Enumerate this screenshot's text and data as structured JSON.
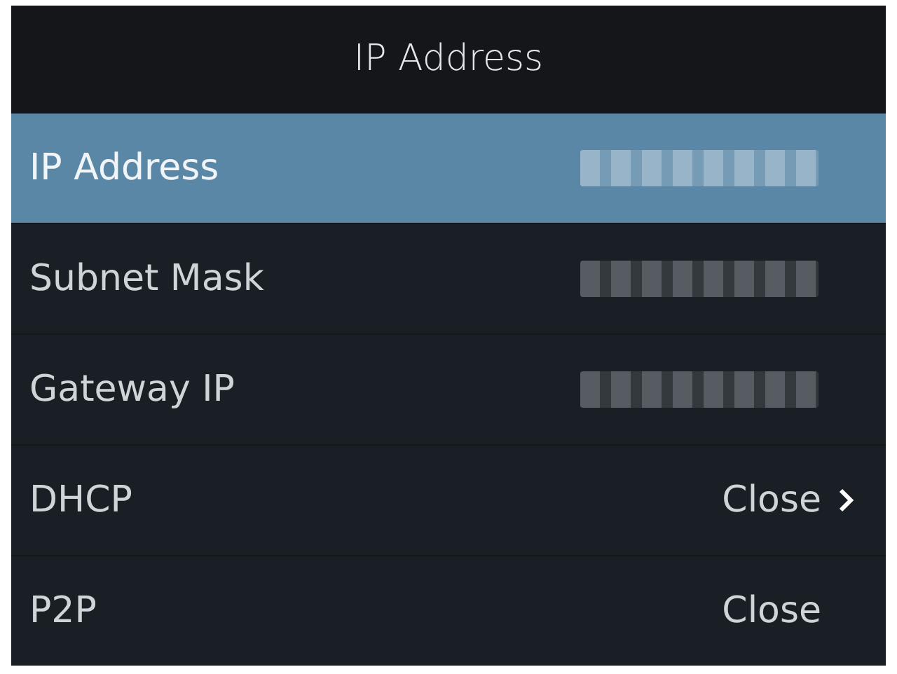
{
  "header": {
    "title": "IP Address"
  },
  "rows": [
    {
      "label": "IP Address",
      "kind": "masked",
      "selected": true,
      "arrow": false
    },
    {
      "label": "Subnet Mask",
      "kind": "masked",
      "selected": false,
      "arrow": false
    },
    {
      "label": "Gateway IP",
      "kind": "masked",
      "selected": false,
      "arrow": false
    },
    {
      "label": "DHCP",
      "kind": "text",
      "value": "Close",
      "selected": false,
      "arrow": true
    },
    {
      "label": "P2P",
      "kind": "text",
      "value": "Close",
      "selected": false,
      "arrow": false
    }
  ]
}
